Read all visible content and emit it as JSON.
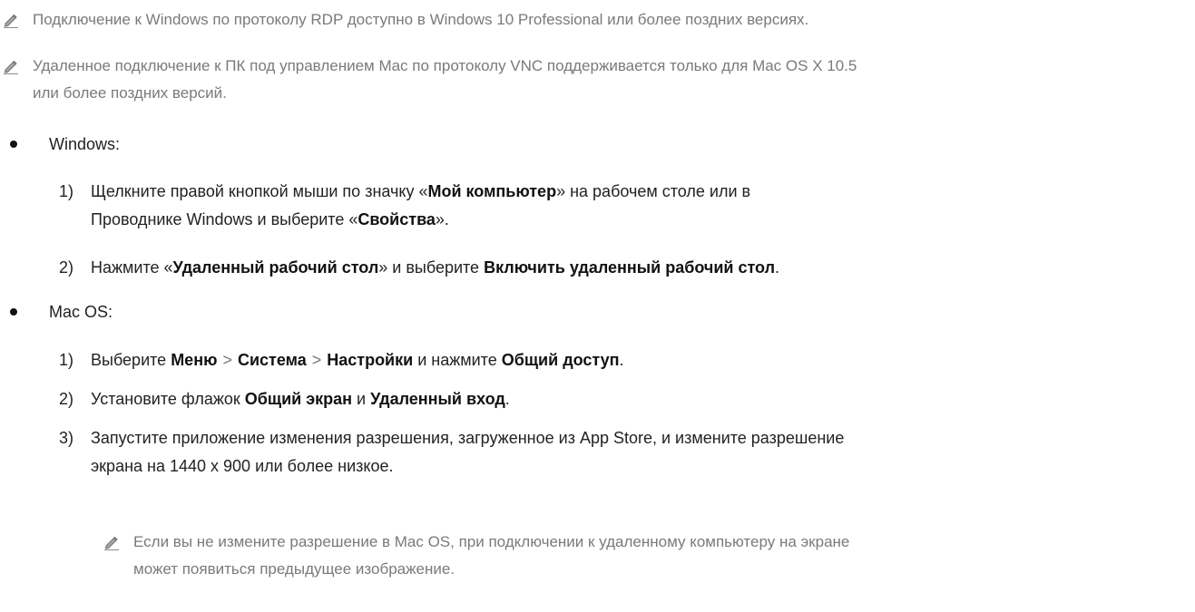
{
  "notes": {
    "rdp": "Подключение к Windows по протоколу RDP доступно в Windows 10 Professional или более поздних версиях.",
    "vnc_line1": "Удаленное подключение к ПК под управлением Mac по протоколу VNC поддерживается только для Mac OS X 10.5",
    "vnc_line2": "или более поздних версий.",
    "mac_res_line1": "Если вы не измените разрешение в Mac OS, при подключении к удаленному компьютеру на экране",
    "mac_res_line2": "может появиться предыдущее изображение."
  },
  "windows": {
    "title": "Windows:",
    "step1": {
      "num": "1)",
      "t1": "Щелкните правой кнопкой мыши по значку «",
      "b1": "Мой компьютер",
      "t2": "» на рабочем столе или в",
      "t3": "Проводнике Windows и выберите «",
      "b2": "Свойства",
      "t4": "»."
    },
    "step2": {
      "num": "2)",
      "t1": "Нажмите «",
      "b1": "Удаленный рабочий стол",
      "t2": "» и выберите ",
      "b2": "Включить удаленный рабочий стол",
      "t3": "."
    }
  },
  "mac": {
    "title": "Mac OS:",
    "step1": {
      "num": "1)",
      "t1": "Выберите ",
      "b1": "Меню",
      "sep": ">",
      "b2": "Система",
      "b3": "Настройки",
      "t2": " и нажмите ",
      "b4": "Общий доступ",
      "t3": "."
    },
    "step2": {
      "num": "2)",
      "t1": "Установите флажок ",
      "b1": "Общий экран",
      "t2": " и ",
      "b2": "Удаленный вход",
      "t3": "."
    },
    "step3": {
      "num": "3)",
      "line1": "Запустите приложение изменения разрешения, загруженное из App Store, и измените разрешение",
      "line2": "экрана на 1440 x 900 или более низкое."
    }
  },
  "icons": {
    "note": "pencil-note-icon"
  }
}
